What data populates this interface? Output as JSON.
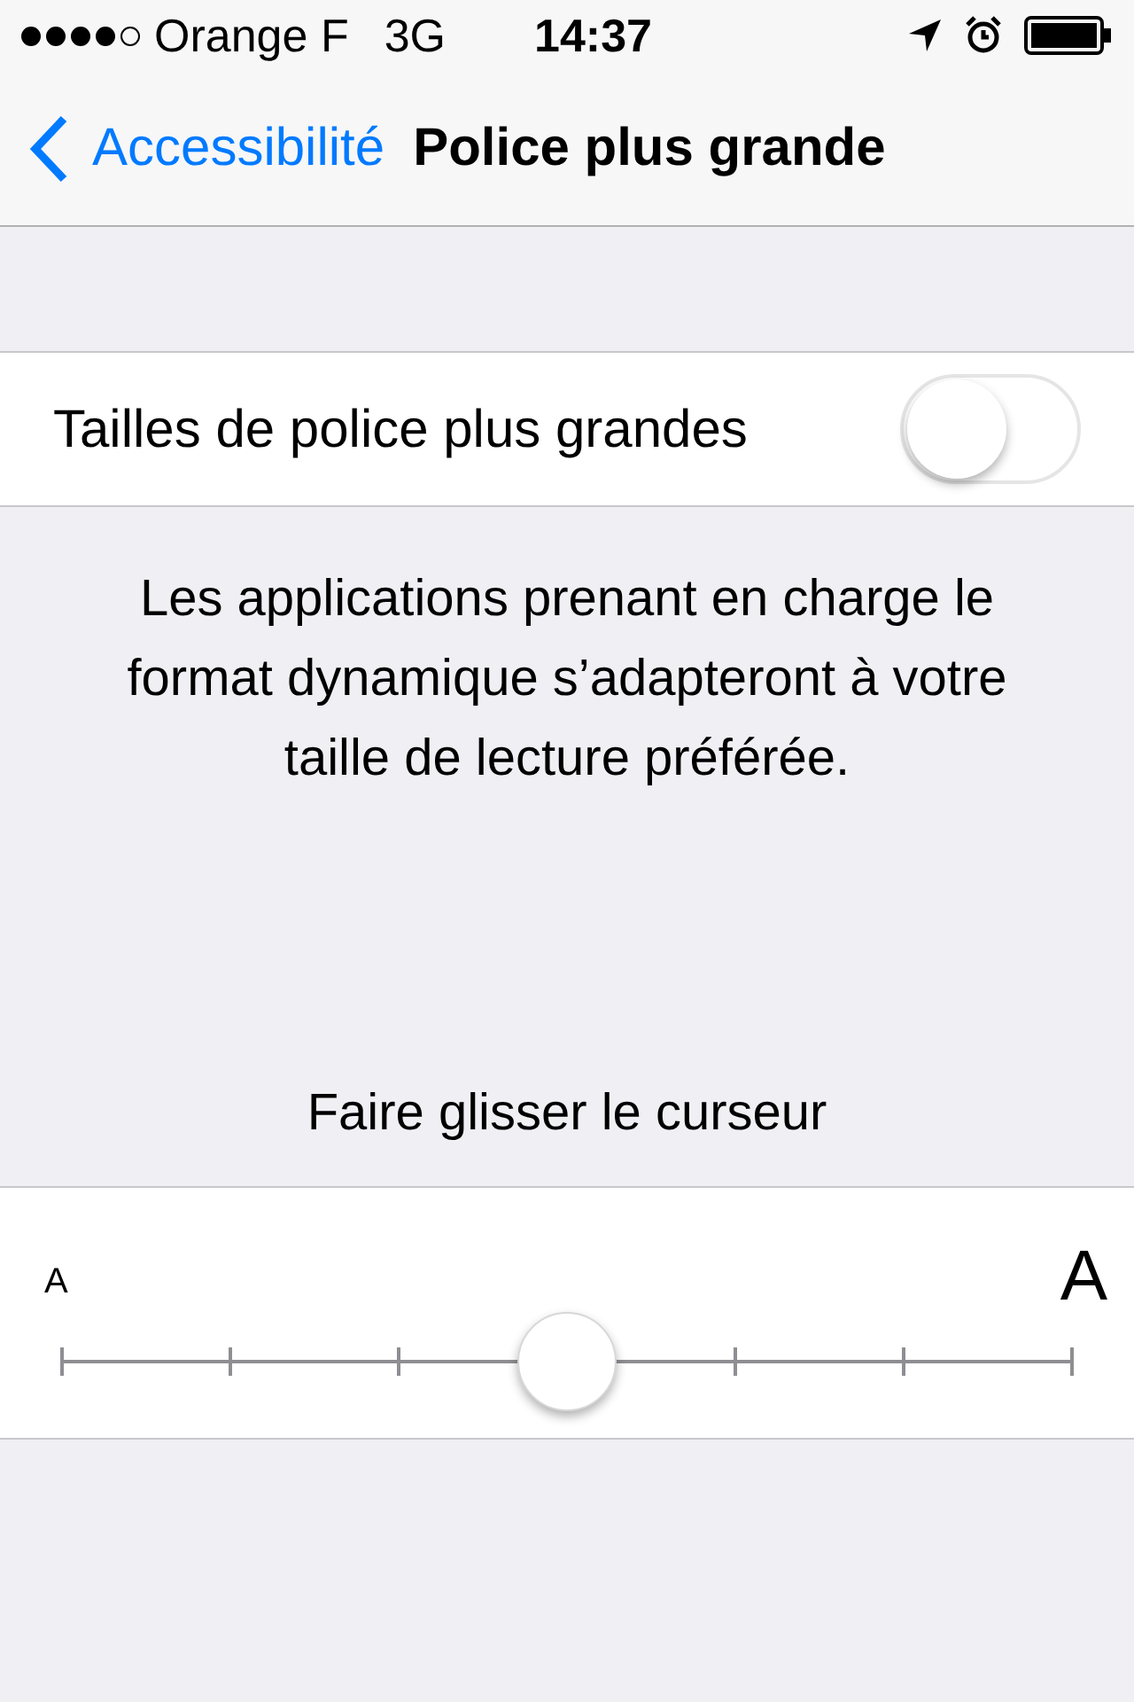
{
  "status_bar": {
    "carrier": "Orange F",
    "network": "3G",
    "time": "14:37"
  },
  "nav": {
    "back": "Accessibilité",
    "title": "Police plus grande"
  },
  "toggle_row": {
    "label": "Tailles de police plus grandes",
    "on": false
  },
  "description": "Les applications prenant en charge le format dynamique s’adapteront à votre taille de lecture préférée.",
  "slider_hint": "Faire glisser le curseur",
  "slider": {
    "small_label": "A",
    "large_label": "A",
    "level": 0.5
  }
}
